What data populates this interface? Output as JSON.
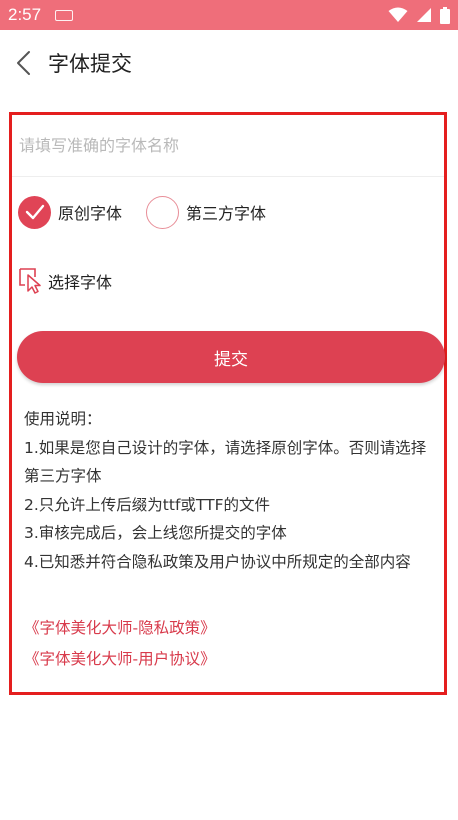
{
  "status_bar": {
    "time": "2:57",
    "bg_color": "#ef6e7a"
  },
  "app_bar": {
    "title": "字体提交",
    "back_icon": "chevron-left-icon"
  },
  "form": {
    "name_placeholder": "请填写准确的字体名称",
    "name_value": "",
    "radio_options": [
      {
        "label": "原创字体",
        "checked": true
      },
      {
        "label": "第三方字体",
        "checked": false
      }
    ],
    "select_font_label": "选择字体",
    "submit_label": "提交",
    "accent_color": "#dd4152"
  },
  "instructions": {
    "heading": "使用说明：",
    "items": [
      "1.如果是您自己设计的字体，请选择原创字体。否则请选择第三方字体",
      "2.只允许上传后缀为ttf或TTF的文件",
      "3.审核完成后，会上线您所提交的字体",
      "4.已知悉并符合隐私政策及用户协议中所规定的全部内容"
    ]
  },
  "links": {
    "privacy": "《字体美化大师-隐私政策》",
    "agreement": "《字体美化大师-用户协议》"
  }
}
